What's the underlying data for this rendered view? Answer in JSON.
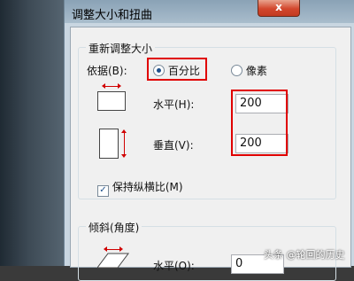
{
  "window": {
    "title": "调整大小和扭曲",
    "close_symbol": "x"
  },
  "resize": {
    "group_title": "重新调整大小",
    "by_label": "依据(B):",
    "option_percent": "百分比",
    "option_pixels": "像素",
    "selected": "百分比",
    "horizontal_label": "水平(H):",
    "horizontal_value": "200",
    "vertical_label": "垂直(V):",
    "vertical_value": "200",
    "keep_ratio_label": "保持纵横比(M)",
    "keep_ratio_checked": "✓"
  },
  "skew": {
    "group_title": "倾斜(角度)",
    "horizontal_label": "水平(O):",
    "horizontal_value": "0"
  },
  "watermark": "头条 @轮回的历史",
  "colors": {
    "highlight": "#e00000",
    "arrow": "#d00000",
    "dialog_bg": "#f0f0f0"
  }
}
